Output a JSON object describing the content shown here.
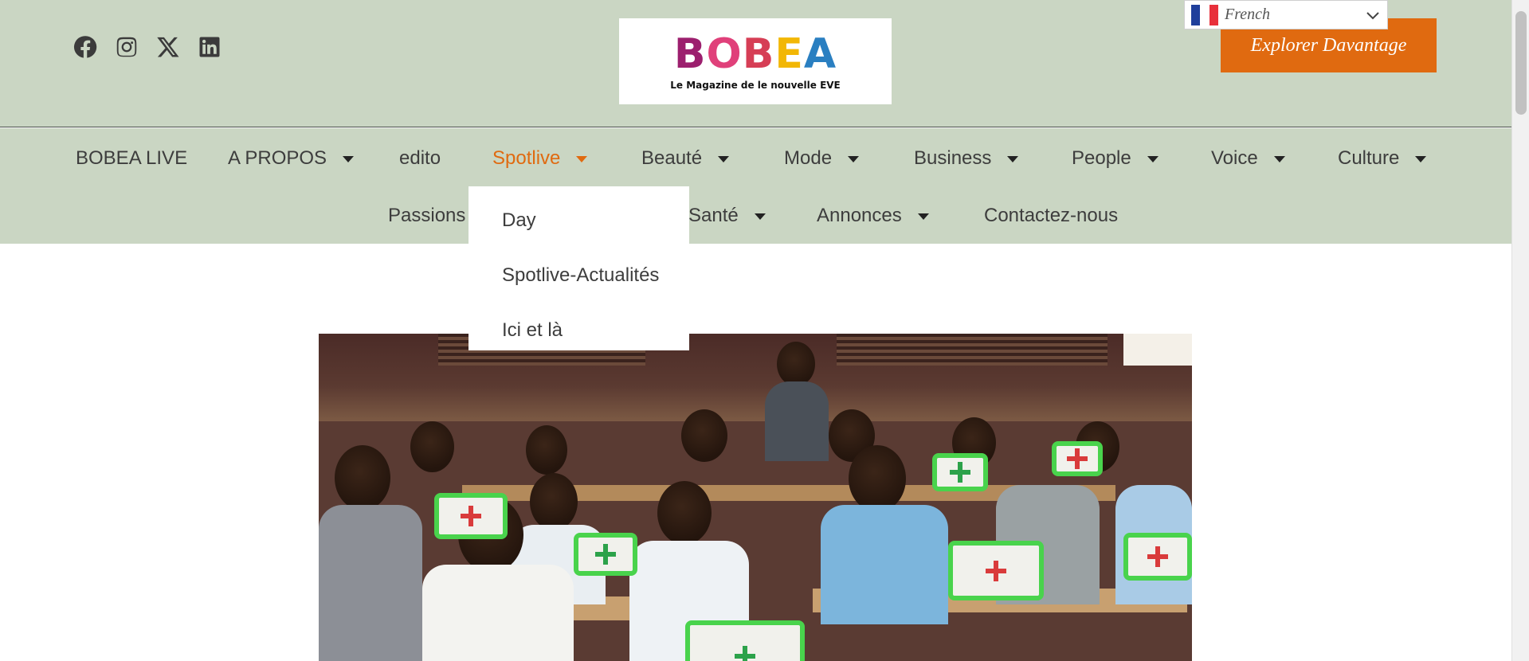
{
  "header": {
    "social": [
      {
        "name": "facebook-icon"
      },
      {
        "name": "instagram-icon"
      },
      {
        "name": "x-icon"
      },
      {
        "name": "linkedin-icon"
      }
    ],
    "logo": {
      "letters": [
        "B",
        "O",
        "B",
        "E",
        "A"
      ],
      "tagline": "Le Magazine de le nouvelle EVE"
    },
    "language": {
      "label": "French",
      "icon": "chevron-down-icon"
    },
    "cta_label": "Explorer Davantage",
    "colors": {
      "band": "#cad6c3",
      "accent": "#e06a10"
    }
  },
  "nav": {
    "row1": [
      {
        "label": "BOBEA LIVE",
        "dropdown": false
      },
      {
        "label": "A PROPOS",
        "dropdown": true
      },
      {
        "label": "edito",
        "dropdown": false
      },
      {
        "label": "Spotlive",
        "dropdown": true,
        "active": true
      },
      {
        "label": "Beauté",
        "dropdown": true
      },
      {
        "label": "Mode",
        "dropdown": true
      },
      {
        "label": "Business",
        "dropdown": true
      },
      {
        "label": "People",
        "dropdown": true
      },
      {
        "label": "Voice",
        "dropdown": true
      },
      {
        "label": "Culture",
        "dropdown": true
      }
    ],
    "row2": [
      {
        "label": "Passions",
        "dropdown": false
      },
      {
        "label": "Santé",
        "dropdown": true
      },
      {
        "label": "Annonces",
        "dropdown": true
      },
      {
        "label": "Contactez-nous",
        "dropdown": false
      }
    ]
  },
  "dropdown": {
    "items": [
      "Day",
      "Spotlive-Actualités",
      "Ici et là"
    ]
  }
}
